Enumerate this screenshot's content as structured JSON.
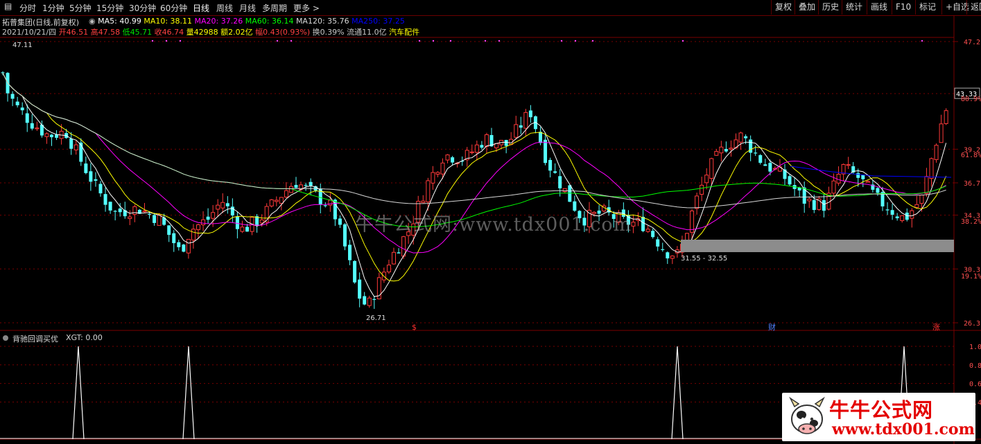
{
  "toolbar": {
    "periods": [
      "分时",
      "1分钟",
      "5分钟",
      "15分钟",
      "30分钟",
      "60分钟",
      "日线",
      "周线",
      "月线",
      "多周期",
      "更多"
    ],
    "selected": "日线",
    "right_buttons": [
      "复权",
      "叠加",
      "历史",
      "统计",
      "画线",
      "F10",
      "标记",
      "+自选",
      "返回"
    ]
  },
  "header": {
    "stock_name": "拓普集团(日线,前复权)",
    "ma": [
      {
        "label": "MA5: 40.99",
        "color": "#ffffff"
      },
      {
        "label": "MA10: 38.11",
        "color": "#ffff00"
      },
      {
        "label": "MA20: 37.26",
        "color": "#ff00ff"
      },
      {
        "label": "MA60: 36.14",
        "color": "#00ff00"
      },
      {
        "label": "MA120: 35.76",
        "color": "#d8d8d8"
      },
      {
        "label": "MA250: 37.25",
        "color": "#0000ff"
      }
    ],
    "info": [
      {
        "label": "2021/10/21/四",
        "color": "#c8c8c8"
      },
      {
        "label": "开46.51",
        "color": "#ff4040"
      },
      {
        "label": "高47.58",
        "color": "#ff4040"
      },
      {
        "label": "低45.71",
        "color": "#00e000"
      },
      {
        "label": "收46.74",
        "color": "#ff4040"
      },
      {
        "label": "量42988",
        "color": "#ffff00"
      },
      {
        "label": "额2.02亿",
        "color": "#ffff00"
      },
      {
        "label": "幅0.43(0.93%)",
        "color": "#ff4040"
      },
      {
        "label": "换0.39%",
        "color": "#c8c8c8"
      },
      {
        "label": "流通11.0亿",
        "color": "#c8c8c8"
      },
      {
        "label": "汽车配件",
        "color": "#ffff00"
      }
    ]
  },
  "price_axis": {
    "ticks": [
      "47.2",
      "43.33",
      "39.2",
      "36.7",
      "34.3",
      "30.3",
      "26.3"
    ],
    "secondary_ticks": [
      "80.9%",
      "61.8%",
      "38.2%",
      "19.1%"
    ],
    "last_price": "43.33"
  },
  "annotations": {
    "high_label": "47.11",
    "low_label": "26.71",
    "zone_label": "31.55 - 32.55",
    "markers": [
      "$",
      "财",
      "涨"
    ]
  },
  "indicator": {
    "title": "背驰回调买优",
    "value": "XGT: 0.00",
    "ticks": [
      "1.0",
      "0.8",
      "0.6",
      "0.4"
    ],
    "spikes_x": [
      113,
      272,
      977,
      1304
    ]
  },
  "watermark": "牛牛公式网:www.tdx001.com",
  "logo": {
    "title": "牛牛公式网",
    "url": "www.tdx001.com"
  },
  "colors": {
    "up": "#ff3a3a",
    "down": "#54ffff",
    "grid": "#7a0000",
    "axis_text": "#ff5050"
  }
}
